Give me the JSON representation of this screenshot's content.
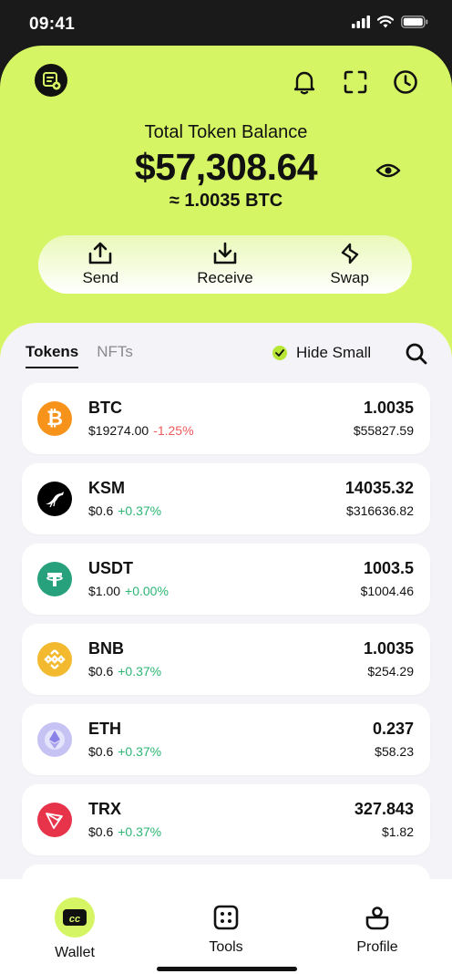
{
  "status_bar": {
    "time": "09:41"
  },
  "header": {
    "balance_label": "Total Token Balance",
    "balance": "$57,308.64",
    "btc_equiv": "≈ 1.0035 BTC"
  },
  "actions": [
    {
      "label": "Send",
      "icon": "upload-tray-icon"
    },
    {
      "label": "Receive",
      "icon": "download-tray-icon"
    },
    {
      "label": "Swap",
      "icon": "swap-bolt-icon"
    }
  ],
  "tabs": [
    {
      "label": "Tokens",
      "active": true
    },
    {
      "label": "NFTs",
      "active": false
    }
  ],
  "filter": {
    "hide_small_label": "Hide Small",
    "hide_small_checked": true
  },
  "tokens": [
    {
      "symbol": "BTC",
      "price": "$19274.00",
      "change": "-1.25%",
      "direction": "down",
      "amount": "1.0035",
      "value": "$55827.59",
      "color": "#f7931a"
    },
    {
      "symbol": "KSM",
      "price": "$0.6",
      "change": "+0.37%",
      "direction": "up",
      "amount": "14035.32",
      "value": "$316636.82",
      "color": "#000000"
    },
    {
      "symbol": "USDT",
      "price": "$1.00",
      "change": "+0.00%",
      "direction": "up",
      "amount": "1003.5",
      "value": "$1004.46",
      "color": "#26a17b"
    },
    {
      "symbol": "BNB",
      "price": "$0.6",
      "change": "+0.37%",
      "direction": "up",
      "amount": "1.0035",
      "value": "$254.29",
      "color": "#f3ba2f"
    },
    {
      "symbol": "ETH",
      "price": "$0.6",
      "change": "+0.37%",
      "direction": "up",
      "amount": "0.237",
      "value": "$58.23",
      "color": "#c6c3f4"
    },
    {
      "symbol": "TRX",
      "price": "$0.6",
      "change": "+0.37%",
      "direction": "up",
      "amount": "327.843",
      "value": "$1.82",
      "color": "#e8344b"
    }
  ],
  "bottom_nav": [
    {
      "label": "Wallet",
      "icon": "wallet-cc-icon",
      "active": true
    },
    {
      "label": "Tools",
      "icon": "tools-grid-icon",
      "active": false
    },
    {
      "label": "Profile",
      "icon": "profile-icon",
      "active": false
    }
  ],
  "colors": {
    "accent": "#d6f564",
    "positive": "#2bb673",
    "negative": "#ef5a5a"
  }
}
